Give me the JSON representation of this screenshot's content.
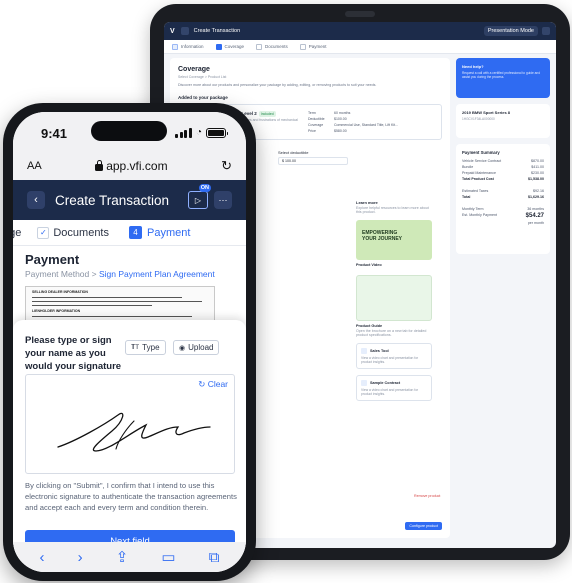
{
  "tablet": {
    "title": "Create Transaction",
    "presentation_mode": "Presentation Mode",
    "steps": [
      "Information",
      "Coverage",
      "Documents",
      "Payment"
    ],
    "coverage_title": "Coverage",
    "breadcrumb": "Select Coverage > Product List",
    "description": "Discover more about our products and personalize your package by adding, editing, or removing products to suit your needs.",
    "added_title": "Added to your package",
    "product_name": "Vehicle Service Contract - Level 2",
    "product_tag": "Included",
    "product_desc": "Protection against the unexpected expenses and frustrations of mechanical breakdowns.",
    "terms": [
      [
        "Term",
        "60 months"
      ],
      [
        "Deductible",
        "$100.00"
      ],
      [
        "Coverage",
        "Commercial Use, Standard Title, Lift Kit..."
      ],
      [
        "Price",
        "$580.00"
      ]
    ],
    "deductible_label": "Select deductible",
    "deductible_value": "$ 100.00",
    "learn_title": "Learn more",
    "learn_desc": "Explore helpful resources to learn more about this product.",
    "thumb_text": "EMPOWERING YOUR JOURNEY",
    "video_caption": "Product Video",
    "guide_title": "Product Guide",
    "guide_desc": "Open the brochure on a new tab for detailed product specifications.",
    "sales_tool": "Sales Tool",
    "sales_desc": "View a video chart and presentation for product insights.",
    "sample_contract": "Sample Contract",
    "sample_desc": "View a video chart and presentation for product insights.",
    "remove_product": "Remove product",
    "configure": "Configure product",
    "help_title": "Need help?",
    "help_desc": "Request a call with a certified professional to guide and assist you during the process.",
    "vehicle": "2019 BMW Sport Series 8",
    "vin": "1HGCV1F34LA000000",
    "summary_title": "Payment Summary",
    "summary": [
      [
        "Vehicle Service Contract",
        "$870.00"
      ],
      [
        "Bundle",
        "$411.00"
      ],
      [
        "Prepaid Maintenance",
        "$230.00"
      ],
      [
        "Total Product Cost",
        "$1,538.00"
      ]
    ],
    "taxes": [
      [
        "Estimated Taxes",
        "$92.16"
      ],
      [
        "Total",
        "$1,629.16"
      ]
    ],
    "monthly": [
      [
        "Monthly Term",
        "36 months"
      ],
      [
        "Est. Monthly Payment",
        "$54.27"
      ]
    ],
    "per_month": "per month"
  },
  "phone": {
    "time": "9:41",
    "aa": "AA",
    "url": "app.vfi.com",
    "title": "Create Transaction",
    "on_badge": "ON",
    "step_prev": "age",
    "step_docs": "Documents",
    "step_num": "4",
    "step_payment": "Payment",
    "page_title": "Payment",
    "crumb_1": "Payment Method",
    "crumb_sep": ">",
    "crumb_2": "Sign Payment Plan Agreement",
    "doc_lines": [
      "SELLING DEALER INFORMATION",
      "LIENHOLDER INFORMATION"
    ],
    "sig_prompt": "Please type or sign your name as you would your signature to appear",
    "btn_type": "Type",
    "btn_upload": "Upload",
    "clear": "Clear",
    "legal": "By clicking on \"Submit\", I confirm that I intend to use this electronic signature to authenticate the transaction agreements and accept each and every term and condition therein.",
    "next": "Next field"
  },
  "colors": {
    "accent": "#2f6bf2",
    "header": "#1c2b4a"
  }
}
